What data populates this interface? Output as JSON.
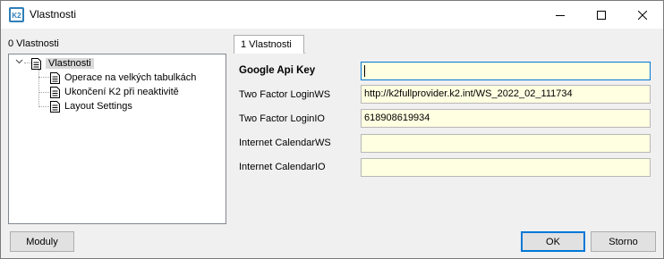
{
  "window": {
    "title": "Vlastnosti",
    "app_icon_text": "K2"
  },
  "left_panel": {
    "label": "0 Vlastnosti",
    "tree": {
      "root": "Vlastnosti",
      "children": [
        "Operace na velkých tabulkách",
        "Ukončení K2 při neaktivitě",
        "Layout Settings"
      ]
    }
  },
  "tab": {
    "label": "1 Vlastnosti"
  },
  "fields": [
    {
      "label": "Google Api Key",
      "value": ""
    },
    {
      "label": "Two Factor LoginWS",
      "value": "http://k2fullprovider.k2.int/WS_2022_02_111734"
    },
    {
      "label": "Two Factor LoginIO",
      "value": "618908619934"
    },
    {
      "label": "Internet CalendarWS",
      "value": ""
    },
    {
      "label": "Internet CalendarIO",
      "value": ""
    }
  ],
  "buttons": {
    "modules": "Moduly",
    "ok": "OK",
    "cancel": "Storno"
  },
  "colors": {
    "field_bg": "#ffffe1",
    "accent": "#0078d7"
  }
}
